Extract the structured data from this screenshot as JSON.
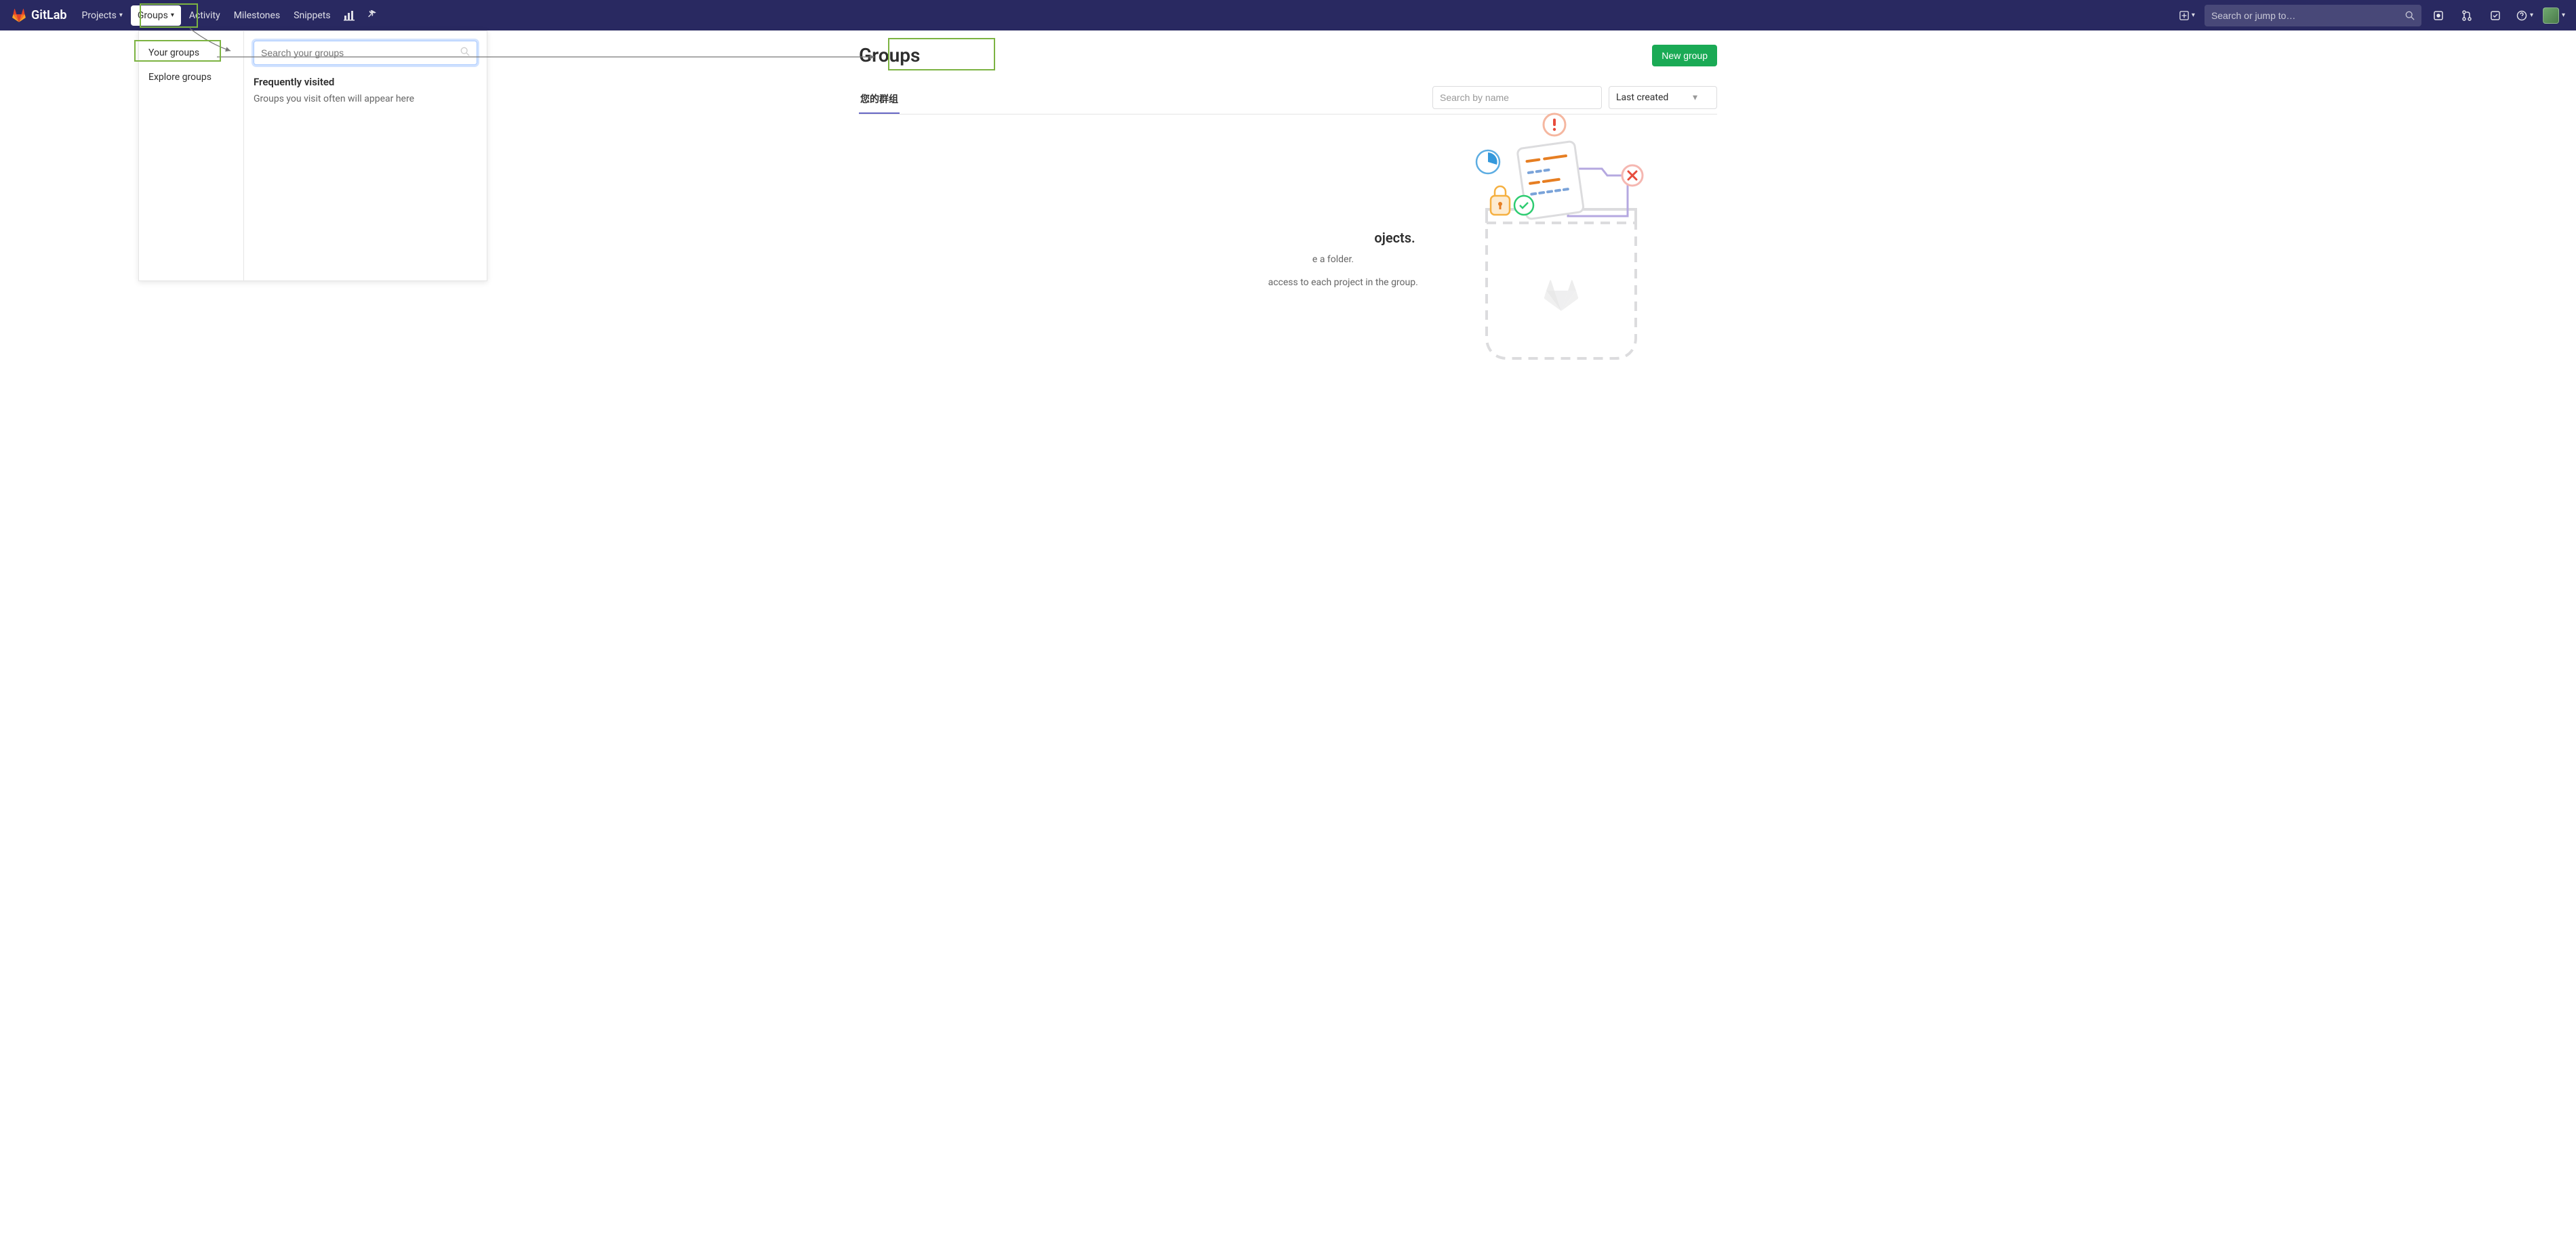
{
  "navbar": {
    "brand": "GitLab",
    "projects": "Projects",
    "groups": "Groups",
    "activity": "Activity",
    "milestones": "Milestones",
    "snippets": "Snippets",
    "search_placeholder": "Search or jump to…"
  },
  "dropdown": {
    "your_groups": "Your groups",
    "explore_groups": "Explore groups",
    "search_placeholder": "Search your groups",
    "freq_title": "Frequently visited",
    "freq_text": "Groups you visit often will appear here"
  },
  "page": {
    "title": "Groups",
    "new_group_btn": "New group",
    "tab_your_groups": "您的群组",
    "filter_placeholder": "Search by name",
    "sort_label": "Last created"
  },
  "empty": {
    "heading_suffix": "ojects.",
    "text1_suffix": "e a folder.",
    "text2_suffix": "access to each project in the group."
  }
}
